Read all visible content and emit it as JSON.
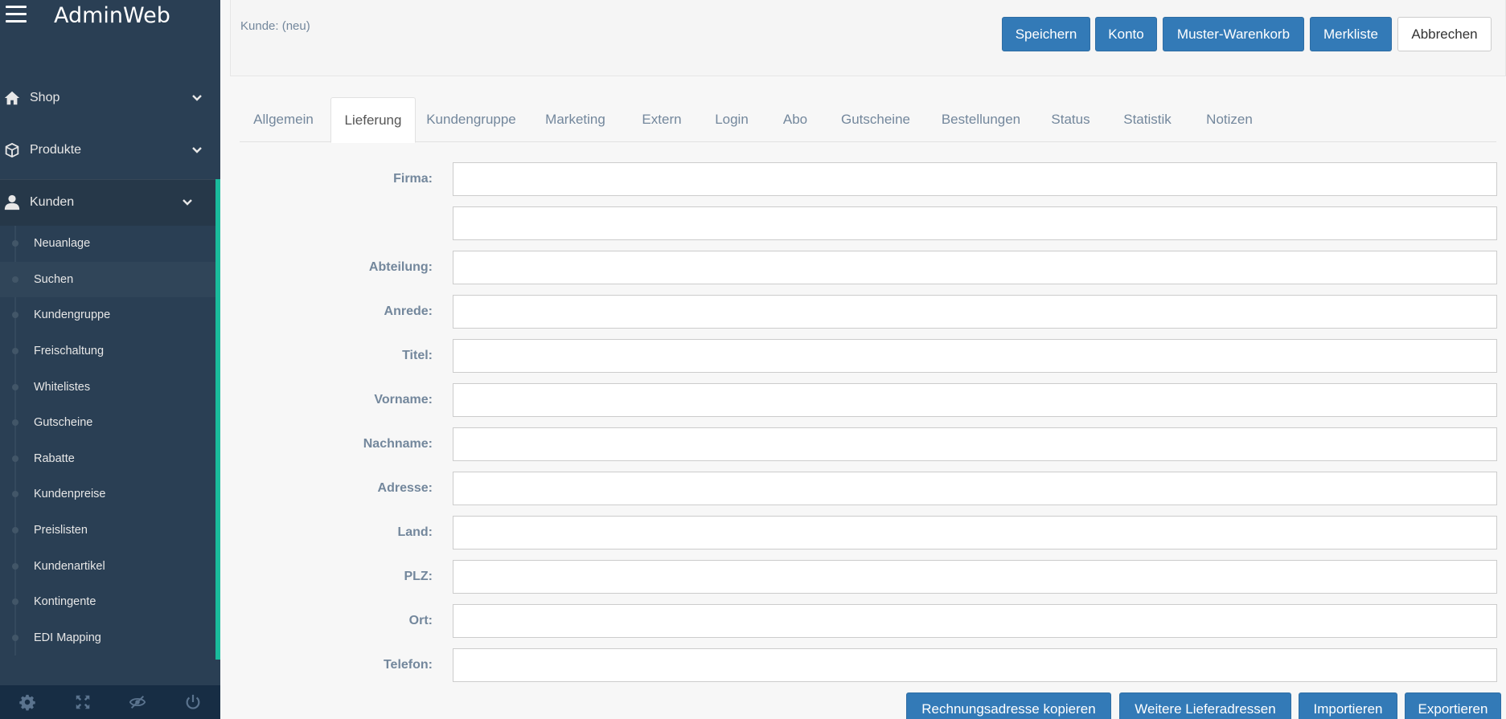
{
  "app": {
    "title": "AdminWeb"
  },
  "sidebar": {
    "top_items": [
      {
        "label": "Shop",
        "icon": "home-icon"
      },
      {
        "label": "Produkte",
        "icon": "cube-icon"
      },
      {
        "label": "Kunden",
        "icon": "user-icon"
      }
    ],
    "sub_items": [
      {
        "label": "Neuanlage"
      },
      {
        "label": "Suchen"
      },
      {
        "label": "Kundengruppe"
      },
      {
        "label": "Freischaltung"
      },
      {
        "label": "Whitelistes"
      },
      {
        "label": "Gutscheine"
      },
      {
        "label": "Rabatte"
      },
      {
        "label": "Kundenpreise"
      },
      {
        "label": "Preislisten"
      },
      {
        "label": "Kundenartikel"
      },
      {
        "label": "Kontingente"
      },
      {
        "label": "EDI Mapping"
      }
    ],
    "footer_icons": [
      "settings-icon",
      "fullscreen-icon",
      "eye-slash-icon",
      "power-icon"
    ]
  },
  "header": {
    "kunde_label": "Kunde: (neu)",
    "buttons": {
      "save": "Speichern",
      "konto": "Konto",
      "muster": "Muster-Warenkorb",
      "merkliste": "Merkliste",
      "cancel": "Abbrechen"
    }
  },
  "tabs": [
    {
      "label": "Allgemein"
    },
    {
      "label": "Lieferung",
      "active": true
    },
    {
      "label": "Kundengruppe"
    },
    {
      "label": "Marketing"
    },
    {
      "label": "Extern"
    },
    {
      "label": "Login"
    },
    {
      "label": "Abo"
    },
    {
      "label": "Gutscheine"
    },
    {
      "label": "Bestellungen"
    },
    {
      "label": "Status"
    },
    {
      "label": "Statistik"
    },
    {
      "label": "Notizen"
    }
  ],
  "form": {
    "firma": {
      "label": "Firma:",
      "value": ""
    },
    "firma2": {
      "value": ""
    },
    "abteilung": {
      "label": "Abteilung:",
      "value": ""
    },
    "anrede": {
      "label": "Anrede:",
      "value": ""
    },
    "titel": {
      "label": "Titel:",
      "value": ""
    },
    "vorname": {
      "label": "Vorname:",
      "value": ""
    },
    "nachname": {
      "label": "Nachname:",
      "value": ""
    },
    "adresse": {
      "label": "Adresse:",
      "value": ""
    },
    "land": {
      "label": "Land:",
      "value": ""
    },
    "plz": {
      "label": "PLZ:",
      "value": ""
    },
    "ort": {
      "label": "Ort:",
      "value": ""
    },
    "telefon": {
      "label": "Telefon:",
      "value": ""
    }
  },
  "bottom_buttons": {
    "copy": "Rechnungsadresse kopieren",
    "more": "Weitere Lieferadressen",
    "import": "Importieren",
    "export": "Exportieren"
  },
  "colors": {
    "sidebar_bg": "#2a3f54",
    "accent": "#1abb9c",
    "primary_button": "#337ab7"
  }
}
